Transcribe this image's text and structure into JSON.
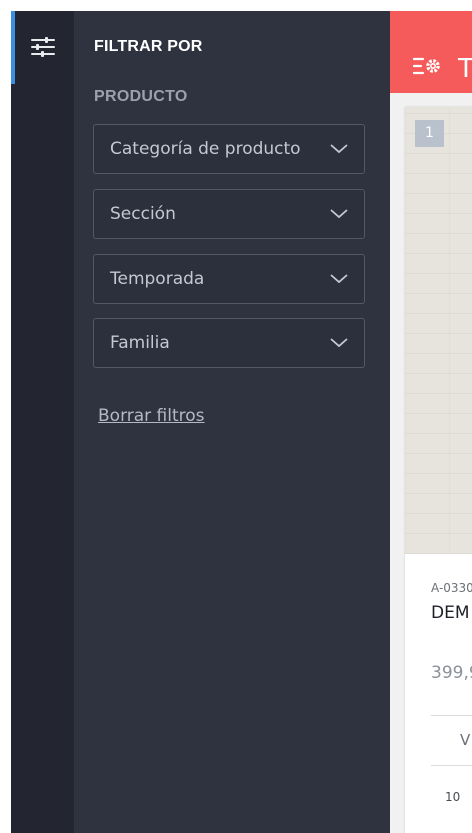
{
  "sidebar": {
    "toggle_icon": "sliders-icon",
    "title": "FILTRAR POR",
    "section": "PRODUCTO",
    "filters": [
      {
        "label": "Categoría de producto"
      },
      {
        "label": "Sección"
      },
      {
        "label": "Temporada"
      },
      {
        "label": "Familia"
      }
    ],
    "clear_filters": "Borrar filtros"
  },
  "header": {
    "icon": "list-settings-icon",
    "title": "T"
  },
  "product_card": {
    "badge": "1",
    "reference": "A-0330",
    "name": "DEM",
    "price": "399,9",
    "column_header": "V",
    "cell_value": "10"
  },
  "colors": {
    "rail_bg": "#232630",
    "panel_bg": "#2f3340",
    "accent_blue": "#3a8fe0",
    "header_red": "#f65b5b"
  }
}
